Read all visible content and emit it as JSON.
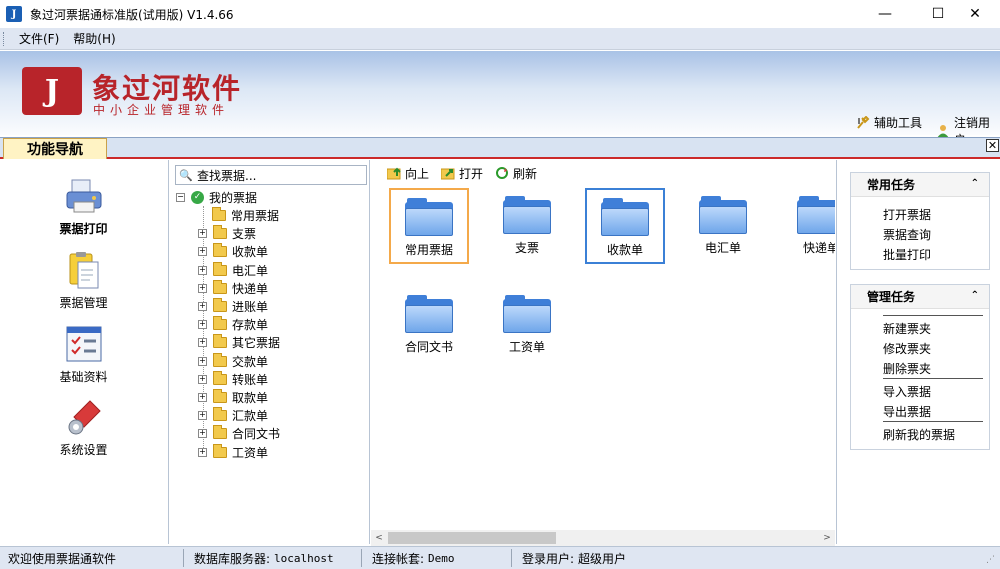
{
  "window": {
    "app_icon_glyph": "J",
    "title": "象过河票据通标准版(试用版) V1.4.66",
    "minimize_glyph": "—",
    "maximize_glyph": "☐",
    "close_glyph": "✕"
  },
  "menu": {
    "items": [
      "文件(F)",
      "帮助(H)"
    ]
  },
  "brand": {
    "logo_glyph": "J",
    "name": "象过河软件",
    "tagline": "中小企业管理软件",
    "color": "#b8242a"
  },
  "banner_tools": [
    {
      "label": "辅助工具",
      "icon": "tools-icon"
    },
    {
      "label": "注销用户",
      "icon": "user-icon"
    }
  ],
  "nav": {
    "tab_label": "功能导航",
    "close_glyph": "✕",
    "buttons": [
      {
        "label": "票据打印",
        "icon": "printer-icon",
        "glyph": "🖨",
        "active": true
      },
      {
        "label": "票据管理",
        "icon": "clipboard-icon",
        "glyph": "📋",
        "active": false
      },
      {
        "label": "基础资料",
        "icon": "checklist-icon",
        "glyph": "☑",
        "active": false
      },
      {
        "label": "系统设置",
        "icon": "wrench-icon",
        "glyph": "🔧",
        "active": false
      }
    ]
  },
  "search": {
    "icon_glyph": "🔍",
    "placeholder": "查找票据..."
  },
  "tree": {
    "root": {
      "label": "我的票据",
      "expander": "⊟"
    },
    "children": [
      {
        "label": "常用票据",
        "expander": ""
      },
      {
        "label": "支票",
        "expander": "+"
      },
      {
        "label": "收款单",
        "expander": "+"
      },
      {
        "label": "电汇单",
        "expander": "+"
      },
      {
        "label": "快递单",
        "expander": "+"
      },
      {
        "label": "进账单",
        "expander": "+"
      },
      {
        "label": "存款单",
        "expander": "+"
      },
      {
        "label": "其它票据",
        "expander": "+"
      },
      {
        "label": "交款单",
        "expander": "+"
      },
      {
        "label": "转账单",
        "expander": "+"
      },
      {
        "label": "取款单",
        "expander": "+"
      },
      {
        "label": "汇款单",
        "expander": "+"
      },
      {
        "label": "合同文书",
        "expander": "+"
      },
      {
        "label": "工资单",
        "expander": "+"
      }
    ]
  },
  "toolbar": {
    "up": {
      "label": "向上",
      "glyph": "↑"
    },
    "open": {
      "label": "打开",
      "glyph": "↗"
    },
    "refresh": {
      "label": "刷新",
      "glyph": "⟳"
    }
  },
  "folders": [
    {
      "label": "常用票据",
      "state": "hover"
    },
    {
      "label": "支票",
      "state": "normal"
    },
    {
      "label": "收款单",
      "state": "selected"
    },
    {
      "label": "电汇单",
      "state": "normal"
    },
    {
      "label": "快递单",
      "state": "normal"
    },
    {
      "label": "合同文书",
      "state": "normal"
    },
    {
      "label": "工资单",
      "state": "normal"
    }
  ],
  "scroll": {
    "left_glyph": "<",
    "right_glyph": ">"
  },
  "tasks": {
    "common": {
      "title": "常用任务",
      "chevron": "⌃",
      "links": [
        "打开票据",
        "票据查询",
        "批量打印"
      ]
    },
    "manage": {
      "title": "管理任务",
      "chevron": "⌃",
      "links": [
        "新建票夹",
        "修改票夹",
        "删除票夹",
        "导入票据",
        "导出票据",
        "刷新我的票据"
      ]
    }
  },
  "status": {
    "welcome": "欢迎使用票据通软件",
    "server_label": "数据库服务器:",
    "server_value": "localhost",
    "account_label": "连接帐套:",
    "account_value": "Demo",
    "user_label": "登录用户:",
    "user_value": "超级用户",
    "resize_glyph": "⋰"
  }
}
